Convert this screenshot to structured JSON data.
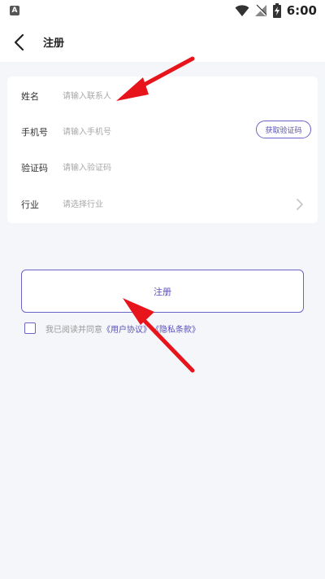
{
  "status_bar": {
    "app_badge": "A",
    "time": "6:00"
  },
  "header": {
    "title": "注册"
  },
  "form": {
    "name": {
      "label": "姓名",
      "placeholder": "请输入联系人"
    },
    "phone": {
      "label": "手机号",
      "placeholder": "请输入手机号",
      "code_button": "获取验证码"
    },
    "code": {
      "label": "验证码",
      "placeholder": "请输入验证码"
    },
    "industry": {
      "label": "行业",
      "placeholder": "请选择行业"
    }
  },
  "register_button": "注册",
  "agreement": {
    "prefix": "我已阅读并同意",
    "user_agreement": "《用户协议》",
    "privacy_policy": "《隐私条款》"
  },
  "colors": {
    "accent": "#6c63c7",
    "annotation_arrow": "#e8141c"
  }
}
